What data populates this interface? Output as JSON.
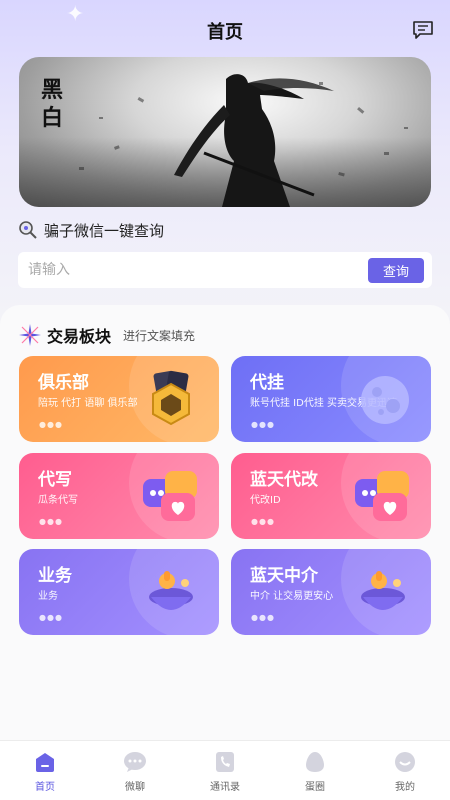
{
  "header": {
    "title": "首页"
  },
  "banner": {
    "text_line1": "黑",
    "text_line2": "白"
  },
  "lookup": {
    "label": "骗子微信一键查询"
  },
  "search": {
    "placeholder": "请输入",
    "button_label": "查询"
  },
  "section": {
    "title": "交易板块",
    "subtitle": "进行文案填充"
  },
  "cards": [
    {
      "title": "俱乐部",
      "desc": "陪玩 代打 语聊 俱乐部",
      "dots": "●●●"
    },
    {
      "title": "代挂",
      "desc": "账号代挂 ID代挂 买卖交易更迅速",
      "dots": "●●●"
    },
    {
      "title": "代写",
      "desc": "瓜条代写",
      "dots": "●●●"
    },
    {
      "title": "蓝天代改",
      "desc": "代改ID",
      "dots": "●●●"
    },
    {
      "title": "业务",
      "desc": "业务",
      "dots": "●●●"
    },
    {
      "title": "蓝天中介",
      "desc": "中介 让交易更安心",
      "dots": "●●●"
    }
  ],
  "tabbar": {
    "items": [
      {
        "label": "首页",
        "icon": "home-icon"
      },
      {
        "label": "微聊",
        "icon": "chat-icon"
      },
      {
        "label": "通讯录",
        "icon": "contacts-icon"
      },
      {
        "label": "蛋圈",
        "icon": "egg-icon"
      },
      {
        "label": "我的",
        "icon": "profile-icon"
      }
    ]
  },
  "colors": {
    "accent": "#6a63e6",
    "card_orange": "#ff9a4d",
    "card_blue": "#6e6ff5",
    "card_pink": "#ff5d8f",
    "card_purple": "#8873f2"
  }
}
